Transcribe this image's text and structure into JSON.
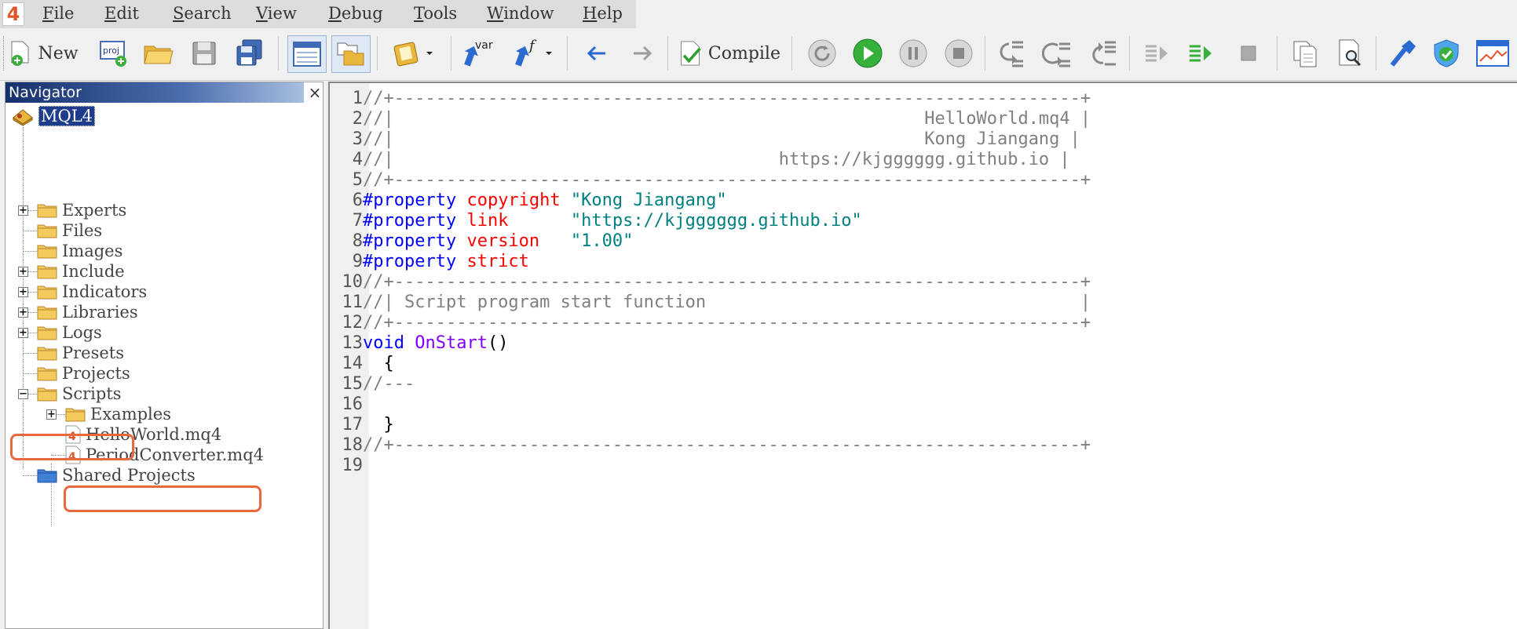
{
  "menu": {
    "items": [
      {
        "label": "File",
        "ul": "F",
        "rest": "ile"
      },
      {
        "label": "Edit",
        "ul": "E",
        "rest": "dit"
      },
      {
        "label": "Search",
        "ul": "S",
        "rest": "earch"
      },
      {
        "label": "View",
        "ul": "V",
        "rest": "iew"
      },
      {
        "label": "Debug",
        "ul": "D",
        "rest": "ebug"
      },
      {
        "label": "Tools",
        "ul": "T",
        "rest": "ools"
      },
      {
        "label": "Window",
        "ul": "W",
        "rest": "indow"
      },
      {
        "label": "Help",
        "ul": "H",
        "rest": "elp"
      }
    ],
    "logo_text": "4"
  },
  "toolbar": {
    "new_label": "New",
    "compile_label": "Compile",
    "proj_text": "proj",
    "var_text": "var",
    "f_text": "f"
  },
  "navigator": {
    "title": "Navigator",
    "close_glyph": "×",
    "root": "MQL4",
    "items": {
      "experts": "Experts",
      "files": "Files",
      "images": "Images",
      "include": "Include",
      "indicators": "Indicators",
      "libraries": "Libraries",
      "logs": "Logs",
      "presets": "Presets",
      "projects": "Projects",
      "scripts": "Scripts",
      "examples": "Examples",
      "helloworld": "HelloWorld.mq4",
      "periodconverter": "PeriodConverter.mq4",
      "shared": "Shared Projects"
    }
  },
  "editor": {
    "lines": [
      {
        "n": "1",
        "segs": [
          {
            "c": "c-comment",
            "t": "//+------------------------------------------------------------------+"
          }
        ]
      },
      {
        "n": "2",
        "segs": [
          {
            "c": "c-comment",
            "t": "//|                                                   HelloWorld.mq4 |"
          }
        ]
      },
      {
        "n": "3",
        "segs": [
          {
            "c": "c-comment",
            "t": "//|                                                   Kong Jiangang |"
          }
        ]
      },
      {
        "n": "4",
        "segs": [
          {
            "c": "c-comment",
            "t": "//|                                     https://kjgggggg.github.io |"
          }
        ]
      },
      {
        "n": "5",
        "segs": [
          {
            "c": "c-comment",
            "t": "//+------------------------------------------------------------------+"
          }
        ]
      },
      {
        "n": "6",
        "segs": [
          {
            "c": "c-kw",
            "t": "#property "
          },
          {
            "c": "c-prop",
            "t": "copyright "
          },
          {
            "c": "c-str",
            "t": "\"Kong Jiangang\""
          }
        ]
      },
      {
        "n": "7",
        "segs": [
          {
            "c": "c-kw",
            "t": "#property "
          },
          {
            "c": "c-prop",
            "t": "link      "
          },
          {
            "c": "c-str",
            "t": "\"https://kjgggggg.github.io\""
          }
        ]
      },
      {
        "n": "8",
        "segs": [
          {
            "c": "c-kw",
            "t": "#property "
          },
          {
            "c": "c-prop",
            "t": "version   "
          },
          {
            "c": "c-str",
            "t": "\"1.00\""
          }
        ]
      },
      {
        "n": "9",
        "segs": [
          {
            "c": "c-kw",
            "t": "#property "
          },
          {
            "c": "c-prop",
            "t": "strict"
          }
        ]
      },
      {
        "n": "10",
        "segs": [
          {
            "c": "c-comment",
            "t": "//+------------------------------------------------------------------+"
          }
        ]
      },
      {
        "n": "11",
        "segs": [
          {
            "c": "c-comment",
            "t": "//| Script program start function                                    |"
          }
        ]
      },
      {
        "n": "12",
        "segs": [
          {
            "c": "c-comment",
            "t": "//+------------------------------------------------------------------+"
          }
        ]
      },
      {
        "n": "13",
        "segs": [
          {
            "c": "c-kw",
            "t": "void "
          },
          {
            "c": "c-fn",
            "t": "OnStart"
          },
          {
            "c": "c-plain",
            "t": "()"
          }
        ]
      },
      {
        "n": "14",
        "segs": [
          {
            "c": "c-plain",
            "t": "  {"
          }
        ]
      },
      {
        "n": "15",
        "segs": [
          {
            "c": "c-comment",
            "t": "//---"
          }
        ]
      },
      {
        "n": "16",
        "segs": [
          {
            "c": "c-plain",
            "t": ""
          }
        ]
      },
      {
        "n": "17",
        "segs": [
          {
            "c": "c-plain",
            "t": "  }"
          }
        ]
      },
      {
        "n": "18",
        "segs": [
          {
            "c": "c-comment",
            "t": "//+------------------------------------------------------------------+"
          }
        ]
      },
      {
        "n": "19",
        "segs": [
          {
            "c": "c-plain",
            "t": ""
          }
        ]
      }
    ]
  },
  "colors": {
    "highlight": "#e8693e",
    "keyword": "#0000ff",
    "property": "#ff0000",
    "string": "#008080",
    "function": "#8000ff",
    "comment": "#808080"
  }
}
